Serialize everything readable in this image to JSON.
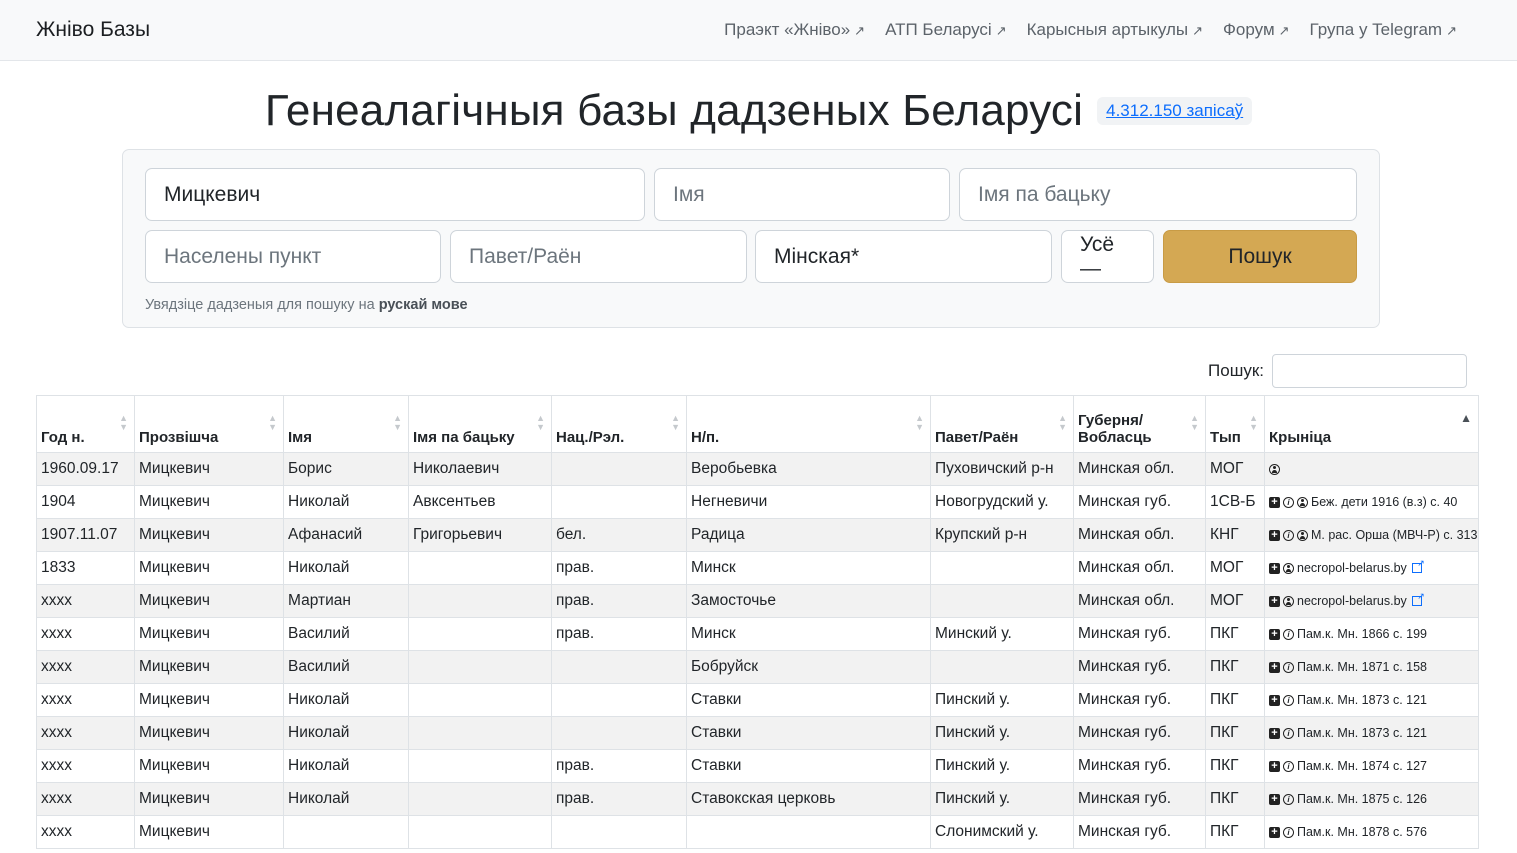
{
  "nav": {
    "brand": "Жніво Базы",
    "links": [
      "Праэкт «Жніво»",
      "АТП Беларусі",
      "Карысныя артыкулы",
      "Форум",
      "Група у Telegram"
    ],
    "arrow": "↗"
  },
  "hero": {
    "title": "Генеалагічныя базы дадзеных Беларусі",
    "records": "4.312.150 запісаў"
  },
  "search": {
    "surname_value": "Мицкевич",
    "name_placeholder": "Імя",
    "patronymic_placeholder": "Імя па бацьку",
    "place_placeholder": "Населены пункт",
    "district_placeholder": "Павет/Раён",
    "region_value": "Мінская*",
    "type_value": "Усё —",
    "button": "Пошук",
    "hint_prefix": "Увядзіце дадзеныя для пошуку на ",
    "hint_bold": "рускай мове"
  },
  "table": {
    "filter_label": "Пошук:",
    "headers": [
      "Год н.",
      "Прозвішча",
      "Імя",
      "Імя па бацьку",
      "Нац./Рэл.",
      "Н/п.",
      "Павет/Раён",
      "Губерня/\nВобласць",
      "Тып",
      "Крыніца"
    ],
    "rows": [
      [
        "1960.09.17",
        "Мицкевич",
        "Борис",
        "Николаевич",
        "",
        "Веробьевка",
        "Пуховичский р-н",
        "Минская обл.",
        "МОГ",
        ""
      ],
      [
        "1904",
        "Мицкевич",
        "Николай",
        "Авксентьев",
        "",
        "Негневичи",
        "Новогрудский у.",
        "Минская губ.",
        "1СВ-Б",
        "Беж. дети 1916 (в.з) с. 40"
      ],
      [
        "1907.11.07",
        "Мицкевич",
        "Афанасий",
        "Григорьевич",
        "бел.",
        "Радица",
        "Крупский р-н",
        "Минская обл.",
        "КНГ",
        "М. рас. Орша (МВЧ-Р) с. 313"
      ],
      [
        "1833",
        "Мицкевич",
        "Николай",
        "",
        "прав.",
        "Минск",
        "",
        "Минская обл.",
        "МОГ",
        "necropol-belarus.by"
      ],
      [
        "xxxx",
        "Мицкевич",
        "Мартиан",
        "",
        "прав.",
        "Замосточье",
        "",
        "Минская обл.",
        "МОГ",
        "necropol-belarus.by"
      ],
      [
        "xxxx",
        "Мицкевич",
        "Василий",
        "",
        "прав.",
        "Минск",
        "Минский у.",
        "Минская губ.",
        "ПКГ",
        "Пам.к. Мн. 1866 с. 199"
      ],
      [
        "xxxx",
        "Мицкевич",
        "Василий",
        "",
        "",
        "Бобруйск",
        "",
        "Минская губ.",
        "ПКГ",
        "Пам.к. Мн. 1871 с. 158"
      ],
      [
        "xxxx",
        "Мицкевич",
        "Николай",
        "",
        "",
        "Ставки",
        "Пинский у.",
        "Минская губ.",
        "ПКГ",
        "Пам.к. Мн. 1873 с. 121"
      ],
      [
        "xxxx",
        "Мицкевич",
        "Николай",
        "",
        "",
        "Ставки",
        "Пинский у.",
        "Минская губ.",
        "ПКГ",
        "Пам.к. Мн. 1873 с. 121"
      ],
      [
        "xxxx",
        "Мицкевич",
        "Николай",
        "",
        "прав.",
        "Ставки",
        "Пинский у.",
        "Минская губ.",
        "ПКГ",
        "Пам.к. Мн. 1874 с. 127"
      ],
      [
        "xxxx",
        "Мицкевич",
        "Николай",
        "",
        "прав.",
        "Ставокская церковь",
        "Пинский у.",
        "Минская губ.",
        "ПКГ",
        "Пам.к. Мн. 1875 с. 126"
      ],
      [
        "xxxx",
        "Мицкевич",
        "",
        "",
        "",
        "",
        "Слонимский у.",
        "Минская губ.",
        "ПКГ",
        "Пам.к. Мн. 1878 с. 576"
      ]
    ],
    "source_icons": [
      [
        "user-icon"
      ],
      [
        "plus-icon",
        "info-icon",
        "user-icon"
      ],
      [
        "plus-icon",
        "info-icon",
        "user-icon"
      ],
      [
        "plus-icon",
        "user-icon",
        "external-link-icon"
      ],
      [
        "plus-icon",
        "user-icon",
        "external-link-icon"
      ],
      [
        "plus-icon",
        "info-icon"
      ],
      [
        "plus-icon",
        "info-icon"
      ],
      [
        "plus-icon",
        "info-icon"
      ],
      [
        "plus-icon",
        "info-icon"
      ],
      [
        "plus-icon",
        "info-icon"
      ],
      [
        "plus-icon",
        "info-icon"
      ],
      [
        "plus-icon",
        "info-icon"
      ]
    ],
    "sorted_column": "Крыніца"
  },
  "colors": {
    "accent_button": "#d4a853",
    "link": "#0d6efd",
    "navbar_bg": "#f8f9fa",
    "row_stripe": "#f2f2f2"
  }
}
